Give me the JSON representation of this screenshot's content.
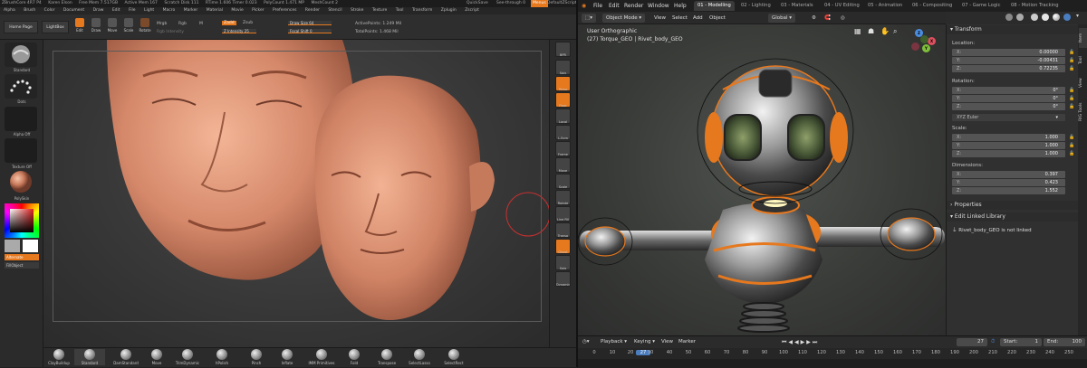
{
  "zbrush": {
    "title_items": [
      "ZBrushCore 4R7 P4",
      "Karen Elson",
      "Free Mem 7.517GB",
      "Active Mem 167",
      "Scratch Disk 111",
      "RTime 1.606 Timer 0.023",
      "PolyCount 1.471 MP",
      "MeshCount 2"
    ],
    "quicksave": "QuickSave",
    "seethrough": "See-through  0",
    "menus_btn": "Menus",
    "default_script": "DefaultZScript",
    "menu": [
      "Alpha",
      "Brush",
      "Color",
      "Document",
      "Draw",
      "Edit",
      "File",
      "Light",
      "Macro",
      "Marker",
      "Material",
      "Movie",
      "Picker",
      "Preferences",
      "Render",
      "Stencil",
      "Stroke",
      "Texture",
      "Tool",
      "Transform",
      "Zplugin",
      "Zscript"
    ],
    "top": {
      "home_page": "Home Page",
      "lightbox": "LightBox",
      "tools": [
        "Edit",
        "Draw",
        "Move",
        "Scale",
        "Rotate"
      ],
      "mrgb": "Mrgb",
      "rgb": "Rgb",
      "m": "M",
      "zadd": "Zadd",
      "zsub": "Zsub",
      "rgb_intensity": "Rgb Intensity",
      "z_intensity": "Z Intensity 25",
      "draw_size": "Draw Size 64",
      "focal_shift": "Focal Shift 0",
      "active_points": "ActivePoints: 1.249 Mil",
      "total_points": "TotalPoints: 1.468 Mil"
    },
    "left": {
      "brush": "Standard",
      "stroke": "Dots",
      "alpha": "Alpha Off",
      "texture": "Texture Off",
      "material": "PolySkin",
      "alternate": "Alternate",
      "fill_object": "FillObject"
    },
    "right": [
      "BPR",
      "Spix",
      "Persp",
      "Floor",
      "Local",
      "L.Sym",
      "Frame",
      "Move",
      "Scale",
      "Rotate",
      "Line Fill PolyF",
      "Transp",
      "Ghost",
      "Solo",
      "Dynamic"
    ],
    "bottom": [
      "ClayBuildup",
      "Standard",
      "DamStandard",
      "Move",
      "TrimDynamic",
      "hPolish",
      "Pinch",
      "Inflate",
      "IMM Primitives",
      "Fold",
      "Transpose",
      "SelectLasso",
      "SelectRect"
    ]
  },
  "blender": {
    "menu": [
      "File",
      "Edit",
      "Render",
      "Window",
      "Help"
    ],
    "workspaces": [
      "01 - Modelling",
      "02 - Lighting",
      "03 - Materials",
      "04 - UV Editing",
      "05 - Animation",
      "06 - Compositing",
      "07 - Game Logic",
      "08 - Motion Tracking"
    ],
    "header": {
      "mode": "Object Mode",
      "view": "View",
      "select": "Select",
      "add": "Add",
      "object": "Object",
      "orientation": "Global"
    },
    "viewport": {
      "projection": "User Orthographic",
      "object_info": "(27) Torque_GEO | Rivet_body_GEO"
    },
    "gizmo": {
      "x": "X",
      "y": "Y",
      "z": "Z"
    },
    "sidebar_tabs": [
      "Item",
      "Tool",
      "View",
      "RIG Tools"
    ],
    "transform": {
      "header": "Transform",
      "location_label": "Location:",
      "location": [
        {
          "k": "X:",
          "v": "0.00000"
        },
        {
          "k": "Y:",
          "v": "-0.00431"
        },
        {
          "k": "Z:",
          "v": "0.72235"
        }
      ],
      "rotation_label": "Rotation:",
      "rotation": [
        {
          "k": "X:",
          "v": "0°"
        },
        {
          "k": "Y:",
          "v": "0°"
        },
        {
          "k": "Z:",
          "v": "0°"
        }
      ],
      "rotation_mode": "XYZ Euler",
      "scale_label": "Scale:",
      "scale": [
        {
          "k": "X:",
          "v": "1.000"
        },
        {
          "k": "Y:",
          "v": "1.000"
        },
        {
          "k": "Z:",
          "v": "1.000"
        }
      ],
      "dimensions_label": "Dimensions:",
      "dimensions": [
        {
          "k": "X:",
          "v": "0.397"
        },
        {
          "k": "Y:",
          "v": "0.423"
        },
        {
          "k": "Z:",
          "v": "1.552"
        }
      ]
    },
    "properties": "Properties",
    "edit_linked": "Edit Linked Library",
    "linked_msg": "Rivet_body_GEO is not linked",
    "timeline": {
      "playback": "Playback",
      "keying": "Keying",
      "view": "View",
      "marker": "Marker",
      "current": "27",
      "start_label": "Start:",
      "start": "1",
      "end_label": "End:",
      "end": "100",
      "ticks": [
        "0",
        "10",
        "20",
        "27",
        "30",
        "40",
        "50",
        "60",
        "70",
        "80",
        "90",
        "100",
        "110",
        "120",
        "130",
        "140",
        "150",
        "160",
        "170",
        "180",
        "190",
        "200",
        "210",
        "220",
        "230",
        "240",
        "250"
      ]
    },
    "colors": {
      "accent": "#e6781e",
      "active_frame": "#4a7dc0",
      "gizmo_x": "#e0505e",
      "gizmo_y": "#7fbf3b",
      "gizmo_z": "#4a8de0"
    }
  }
}
